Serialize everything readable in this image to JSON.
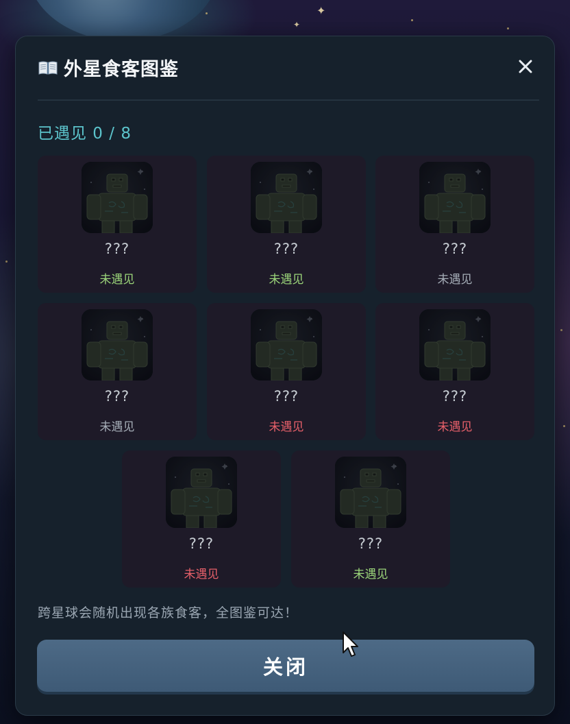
{
  "modal": {
    "title": "外星食客图鉴",
    "title_icon": "open-book-icon",
    "close_icon": "close-icon",
    "encounter_label": "已遇见 0 / 8",
    "hint": "跨星球会随机出现各族食客，全图鉴可达！",
    "close_button_label": "关闭"
  },
  "aliens": [
    {
      "name": "???",
      "status": "未遇见",
      "status_color": "#9cd67a"
    },
    {
      "name": "???",
      "status": "未遇见",
      "status_color": "#9cd67a"
    },
    {
      "name": "???",
      "status": "未遇见",
      "status_color": "#a6aeb8"
    },
    {
      "name": "???",
      "status": "未遇见",
      "status_color": "#a6aeb8"
    },
    {
      "name": "???",
      "status": "未遇见",
      "status_color": "#e8606a"
    },
    {
      "name": "???",
      "status": "未遇见",
      "status_color": "#e8606a"
    },
    {
      "name": "???",
      "status": "未遇见",
      "status_color": "#e8606a"
    },
    {
      "name": "???",
      "status": "未遇见",
      "status_color": "#9cd67a"
    }
  ],
  "colors": {
    "accent": "#5cc4cc",
    "panel": "#16212c",
    "card": "#1e1a28",
    "button": "#4d6a86"
  }
}
